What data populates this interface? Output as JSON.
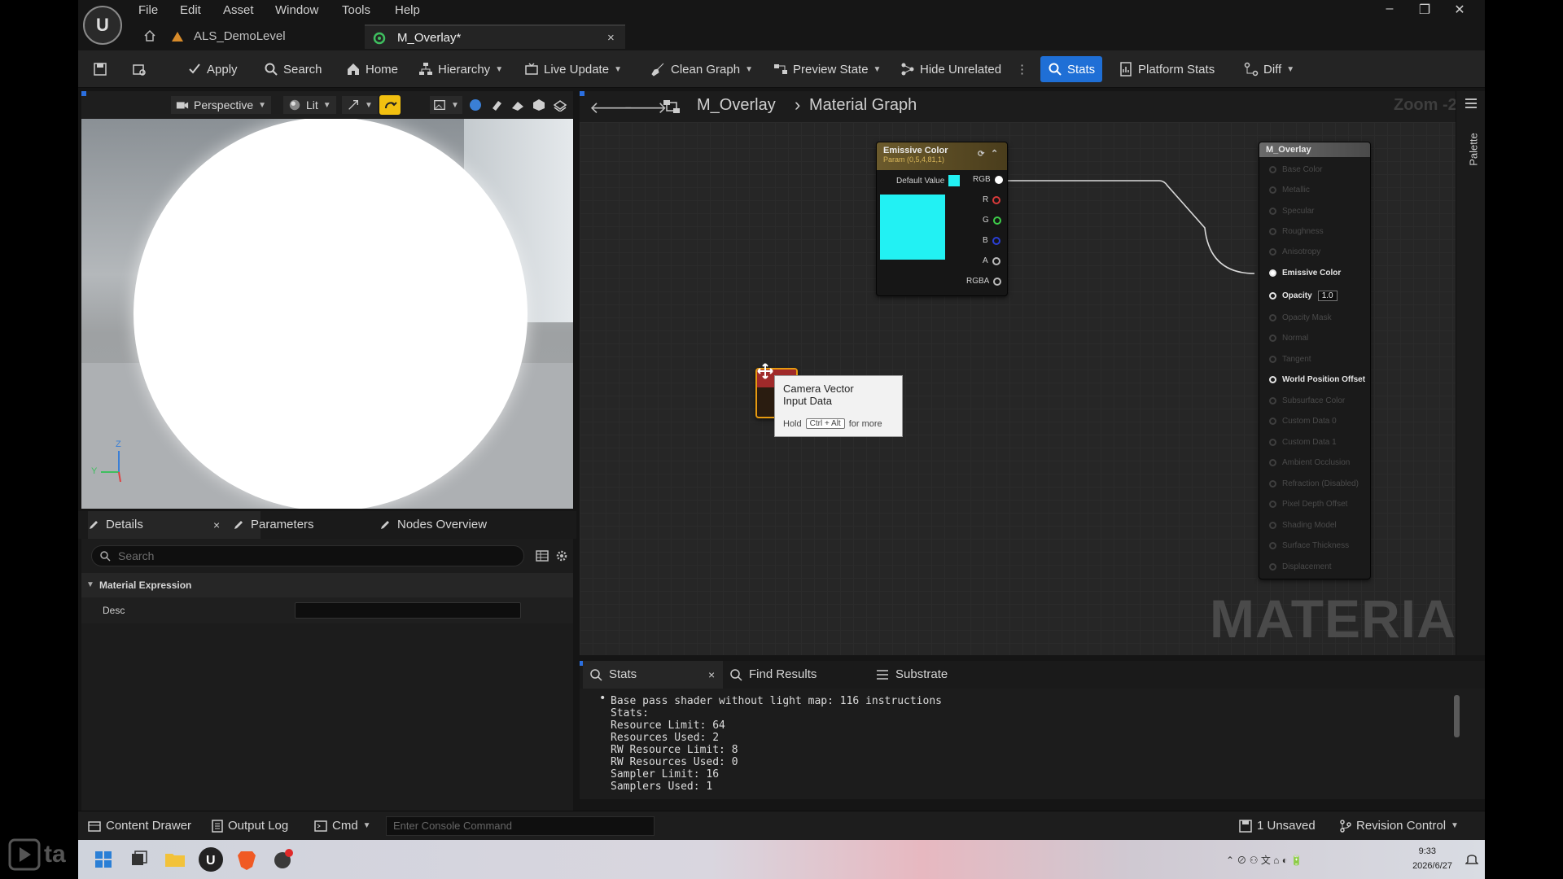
{
  "menu": [
    "File",
    "Edit",
    "Asset",
    "Window",
    "Tools",
    "Help"
  ],
  "tabs": {
    "level": "ALS_DemoLevel",
    "asset": "M_Overlay*",
    "close": "×"
  },
  "window_controls": {
    "minimize": "–",
    "restore": "❐",
    "close": "✕"
  },
  "toolbar": {
    "apply": "Apply",
    "search": "Search",
    "home": "Home",
    "hierarchy": "Hierarchy",
    "live_update": "Live Update",
    "clean_graph": "Clean Graph",
    "preview_state": "Preview State",
    "hide_unrelated": "Hide Unrelated",
    "stats": "Stats",
    "platform_stats": "Platform Stats",
    "diff": "Diff"
  },
  "viewport": {
    "perspective": "Perspective",
    "lit": "Lit",
    "axis_z": "Z",
    "axis_y": "Y"
  },
  "details": {
    "tab_details": "Details",
    "tab_parameters": "Parameters",
    "tab_nodes_overview": "Nodes Overview",
    "search_placeholder": "Search",
    "section": "Material Expression",
    "desc_label": "Desc",
    "desc_value": ""
  },
  "graph": {
    "breadcrumb_root": "M_Overlay",
    "breadcrumb_sep": "›",
    "breadcrumb_leaf": "Material Graph",
    "zoom": "Zoom -2",
    "palette": "Palette",
    "watermark": "MATERIAL"
  },
  "param_node": {
    "title": "Emissive Color",
    "subtitle": "Param (0,5,4,81,1)",
    "default_value_label": "Default Value",
    "color": "#22f1f3",
    "outputs": [
      "RGB",
      "R",
      "G",
      "B",
      "A",
      "RGBA"
    ]
  },
  "result_node": {
    "title": "M_Overlay",
    "pins": [
      "Base Color",
      "Metallic",
      "Specular",
      "Roughness",
      "Anisotropy",
      "Emissive Color",
      "Opacity",
      "Opacity Mask",
      "Normal",
      "Tangent",
      "World Position Offset",
      "Subsurface Color",
      "Custom Data 0",
      "Custom Data 1",
      "Ambient Occlusion",
      "Refraction (Disabled)",
      "Pixel Depth Offset",
      "Shading Model",
      "Surface Thickness",
      "Displacement"
    ],
    "opacity_value": "1.0"
  },
  "tooltip": {
    "title_line1": "Camera Vector",
    "title_line2": "Input Data",
    "hold": "Hold",
    "keys": "Ctrl + Alt",
    "for_more": "for more"
  },
  "stats_panel": {
    "tab_stats": "Stats",
    "tab_find": "Find Results",
    "tab_substrate": "Substrate",
    "lines": [
      "Base pass shader without light map: 116 instructions",
      "Stats:",
      "Resource Limit: 64",
      "Resources Used: 2",
      "RW Resource Limit: 8",
      "RW Resources Used: 0",
      "Sampler Limit: 16",
      "Samplers Used: 1"
    ]
  },
  "statusbar": {
    "content_drawer": "Content Drawer",
    "output_log": "Output Log",
    "cmd": "Cmd",
    "console_placeholder": "Enter Console Command",
    "unsaved": "1 Unsaved",
    "revision_control": "Revision Control"
  },
  "taskbar": {
    "time": "9:33",
    "date": "2026/6/27"
  },
  "corner_logo": "ta",
  "colors": {
    "accent": "#1f6fd6",
    "param_header": "#6b5a2c",
    "result_header": "#5a5a5a",
    "emissive": "#22f1f3"
  }
}
